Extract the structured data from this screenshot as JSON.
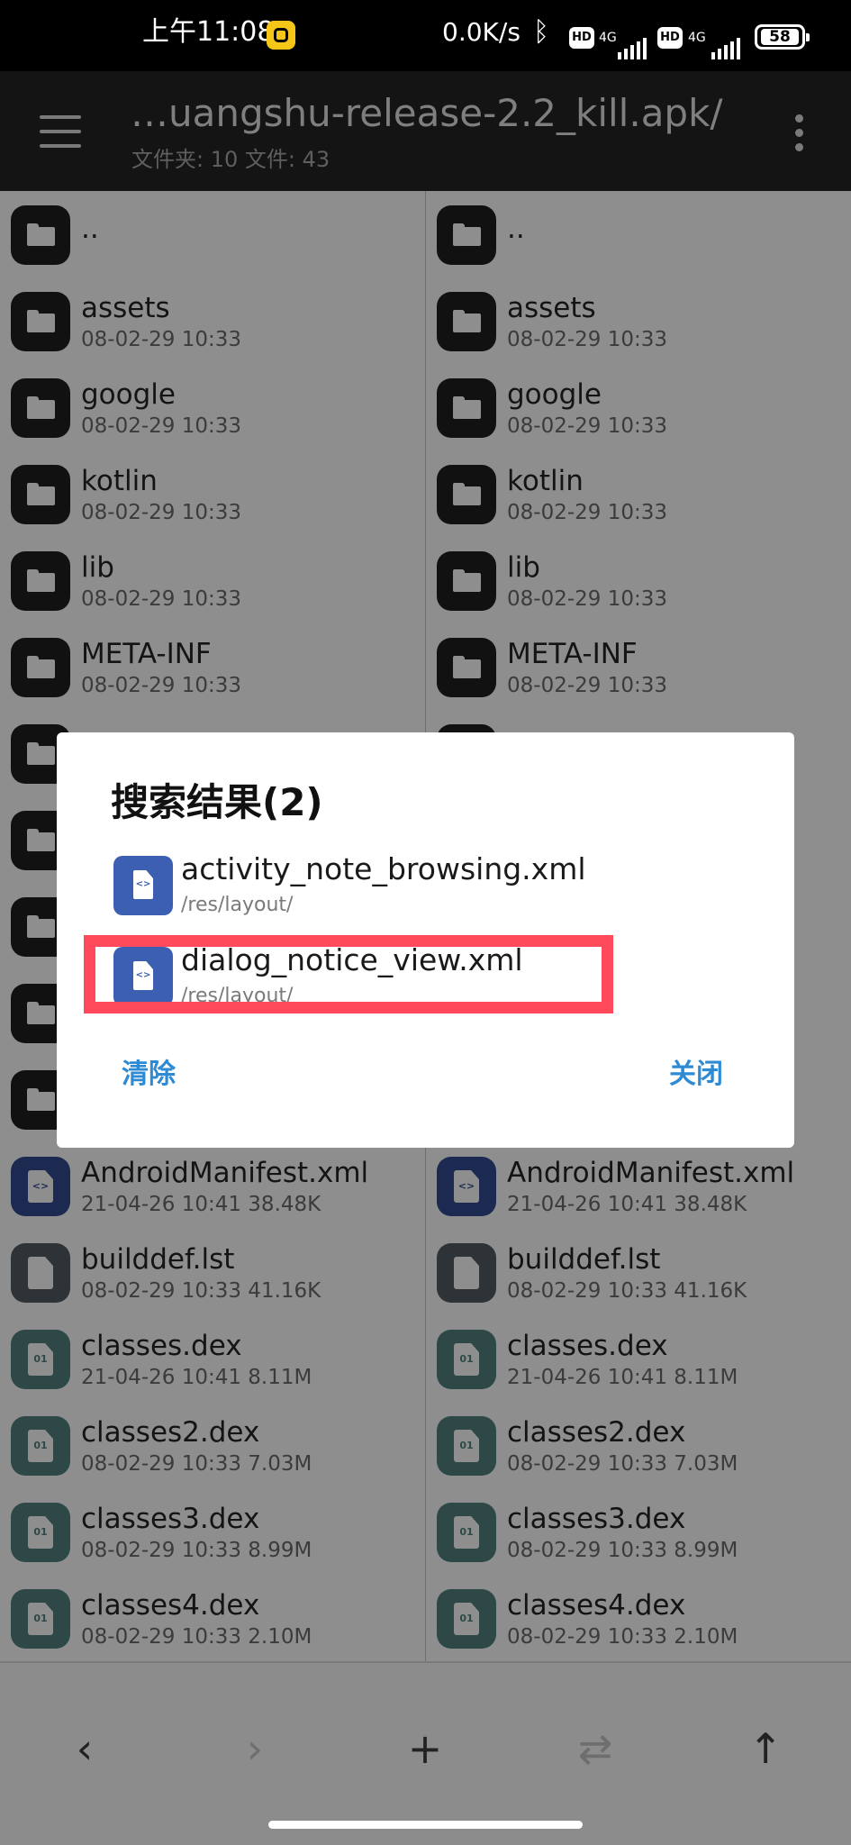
{
  "status_bar": {
    "time": "上午11:08",
    "network_speed": "0.0K/s",
    "hd_badge": "HD",
    "signal_label": "4G",
    "battery": "58"
  },
  "app_bar": {
    "path_title": "…uangshu-release-2.2_kill.apk/",
    "counts": "文件夹: 10  文件: 43"
  },
  "files": [
    {
      "name": "..",
      "meta": "",
      "type": "folder"
    },
    {
      "name": "assets",
      "meta": "08-02-29 10:33",
      "type": "folder"
    },
    {
      "name": "google",
      "meta": "08-02-29 10:33",
      "type": "folder"
    },
    {
      "name": "kotlin",
      "meta": "08-02-29 10:33",
      "type": "folder"
    },
    {
      "name": "lib",
      "meta": "08-02-29 10:33",
      "type": "folder"
    },
    {
      "name": "META-INF",
      "meta": "08-02-29 10:33",
      "type": "folder"
    },
    {
      "name": "",
      "meta": "",
      "type": "folder"
    },
    {
      "name": "",
      "meta": "",
      "type": "folder"
    },
    {
      "name": "",
      "meta": "",
      "type": "folder"
    },
    {
      "name": "",
      "meta": "",
      "type": "folder"
    },
    {
      "name": "",
      "meta": "",
      "type": "folder"
    },
    {
      "name": "AndroidManifest.xml",
      "meta": "21-04-26 10:41  38.48K",
      "type": "xml"
    },
    {
      "name": "builddef.lst",
      "meta": "08-02-29 10:33  41.16K",
      "type": "doc"
    },
    {
      "name": "classes.dex",
      "meta": "21-04-26 10:41  8.11M",
      "type": "dex"
    },
    {
      "name": "classes2.dex",
      "meta": "08-02-29 10:33  7.03M",
      "type": "dex"
    },
    {
      "name": "classes3.dex",
      "meta": "08-02-29 10:33  8.99M",
      "type": "dex"
    },
    {
      "name": "classes4.dex",
      "meta": "08-02-29 10:33  2.10M",
      "type": "dex"
    }
  ],
  "file_icon_glyphs": {
    "xml": "<>",
    "dex": "01"
  },
  "dialog": {
    "title": "搜索结果(2)",
    "results": [
      {
        "name": "activity_note_browsing.xml",
        "path": "/res/layout/"
      },
      {
        "name": "dialog_notice_view.xml",
        "path": "/res/layout/"
      }
    ],
    "clear_label": "清除",
    "close_label": "关闭",
    "icon_glyph": "<>"
  },
  "toolbar": {
    "back_icon": "‹",
    "forward_icon": "›",
    "add_icon": "+",
    "swap_icon": "⇄",
    "up_icon": "↑"
  },
  "colors": {
    "highlight": "#ff4a5b",
    "dialog_button": "#2e8bd3",
    "xml_icon": "#3c5fb1"
  }
}
